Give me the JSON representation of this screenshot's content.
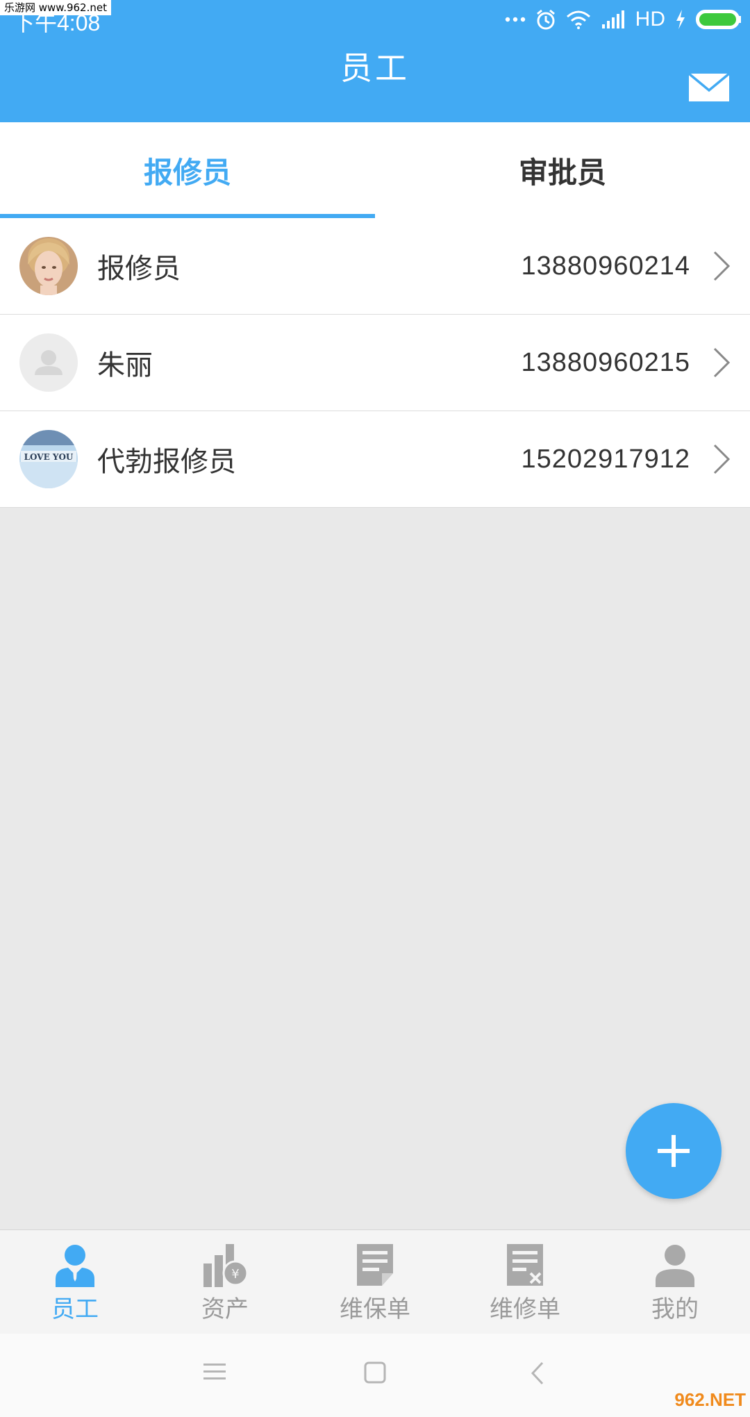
{
  "watermark": "乐游网 www.962.net",
  "status_bar": {
    "time": "下午4:08",
    "network": "HD"
  },
  "header": {
    "title": "员工"
  },
  "tabs": [
    {
      "label": "报修员",
      "active": true
    },
    {
      "label": "审批员",
      "active": false
    }
  ],
  "employees": [
    {
      "name": "报修员",
      "phone": "13880960214",
      "avatar": "photo-woman"
    },
    {
      "name": "朱丽",
      "phone": "13880960215",
      "avatar": "default-user-icon"
    },
    {
      "name": "代勃报修员",
      "phone": "15202917912",
      "avatar": "photo-love-you"
    }
  ],
  "bottom_nav": [
    {
      "label": "员工",
      "icon": "employee-icon",
      "active": true
    },
    {
      "label": "资产",
      "icon": "asset-icon",
      "active": false
    },
    {
      "label": "维保单",
      "icon": "maintenance-order-icon",
      "active": false
    },
    {
      "label": "维修单",
      "icon": "repair-order-icon",
      "active": false
    },
    {
      "label": "我的",
      "icon": "profile-icon",
      "active": false
    }
  ],
  "brandmark": "962.NET",
  "colors": {
    "primary": "#42aaf3",
    "background": "#e9e9e9",
    "text": "#333333",
    "inactive": "#9a9a9a"
  }
}
